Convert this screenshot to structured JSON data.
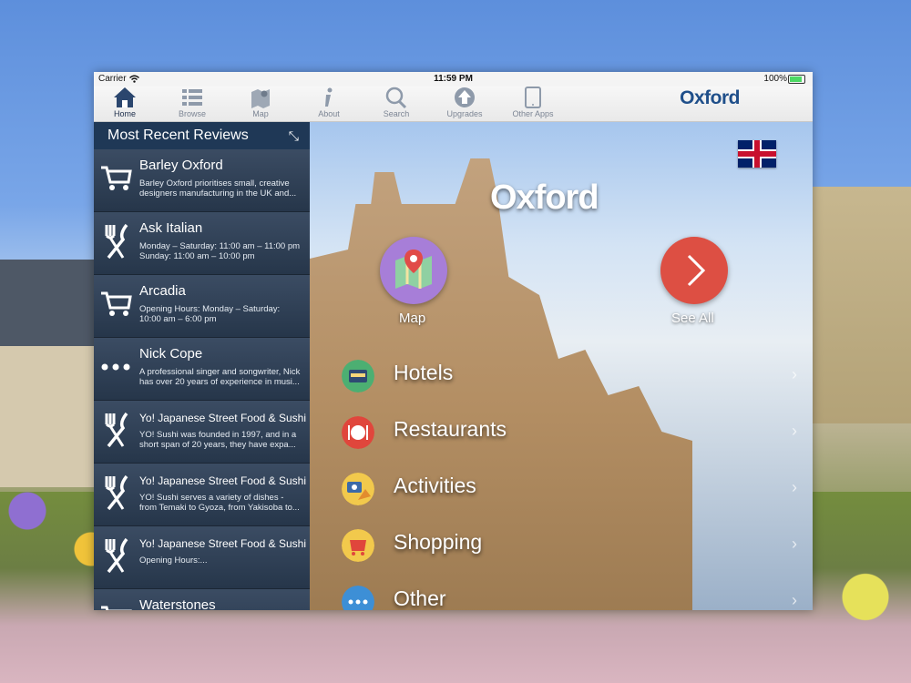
{
  "status_bar": {
    "carrier": "Carrier",
    "time": "11:59 PM",
    "battery": "100%"
  },
  "toolbar": {
    "items": [
      {
        "label": "Home",
        "icon": "home-icon"
      },
      {
        "label": "Browse",
        "icon": "list-icon"
      },
      {
        "label": "Map",
        "icon": "map-icon"
      },
      {
        "label": "About",
        "icon": "info-icon"
      },
      {
        "label": "Search",
        "icon": "search-icon"
      },
      {
        "label": "Upgrades",
        "icon": "upload-icon"
      },
      {
        "label": "Other Apps",
        "icon": "tablet-icon"
      }
    ],
    "brand": "Oxford"
  },
  "sidebar": {
    "title": "Most Recent Reviews",
    "reviews": [
      {
        "icon": "cart-icon",
        "title": "Barley Oxford",
        "desc": "Barley Oxford prioritises small, creative designers manufacturing in the UK and..."
      },
      {
        "icon": "cutlery-icon",
        "title": "Ask Italian",
        "desc": "Monday – Saturday: 11:00 am – 11:00 pm Sunday: 11:00 am – 10:00 pm"
      },
      {
        "icon": "cart-icon",
        "title": "Arcadia",
        "desc": "Opening Hours: Monday – Saturday: 10:00 am – 6:00 pm"
      },
      {
        "icon": "more-icon",
        "title": "Nick Cope",
        "desc": "A professional singer and songwriter, Nick has over 20 years of experience in musi..."
      },
      {
        "icon": "cutlery-icon",
        "title": "Yo! Japanese Street Food & Sushi",
        "desc": "YO! Sushi was founded in 1997, and in a short span of 20 years, they have expa..."
      },
      {
        "icon": "cutlery-icon",
        "title": "Yo! Japanese Street Food & Sushi",
        "desc": "YO! Sushi serves a variety of dishes - from Temaki to Gyoza, from Yakisoba to..."
      },
      {
        "icon": "cutlery-icon",
        "title": "Yo! Japanese Street Food & Sushi",
        "desc": "Opening Hours:..."
      },
      {
        "icon": "cart-icon",
        "title": "Waterstones",
        "desc": ""
      }
    ]
  },
  "hero": {
    "title": "Oxford",
    "map_label": "Map",
    "see_all_label": "See All",
    "categories": [
      {
        "label": "Hotels",
        "icon": "hotel-icon",
        "color": "#4caf72"
      },
      {
        "label": "Restaurants",
        "icon": "restaurant-icon",
        "color": "#e0463c"
      },
      {
        "label": "Activities",
        "icon": "activities-icon",
        "color": "#f2c94c"
      },
      {
        "label": "Shopping",
        "icon": "shopping-icon",
        "color": "#f2c94c"
      },
      {
        "label": "Other",
        "icon": "other-icon",
        "color": "#3d8fd6"
      }
    ]
  }
}
